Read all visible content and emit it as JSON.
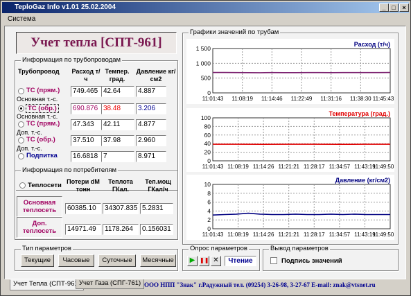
{
  "window": {
    "title": "TeploGaz Info v1.01  25.02.2004",
    "min": "_",
    "max": "□",
    "close": "×"
  },
  "menu": {
    "system": "Система"
  },
  "heat_title": "Учет тепла [СПТ-961]",
  "pipes": {
    "group_label": "Информация по трубопроводам",
    "headers": [
      "Трубопровод",
      "Расход т/ч",
      "Темпер. град.",
      "Давление кг/см2"
    ],
    "rows": [
      {
        "label": "ТС (прям.)",
        "sub": "Основная т.-с.",
        "flow": "749.465",
        "temp": "42.64",
        "press": "4.887",
        "selected": false
      },
      {
        "label": "ТС (обр.)",
        "sub": "Основная т.-с.",
        "flow": "690.876",
        "temp": "38.48",
        "press": "3.206",
        "selected": true
      },
      {
        "label": "ТС (прям.)",
        "sub": "Доп. т.-с.",
        "flow": "47.343",
        "temp": "42.11",
        "press": "4.877",
        "selected": false
      },
      {
        "label": "ТС (обр.)",
        "sub": "Доп. т.-с.",
        "flow": "37.510",
        "temp": "37.98",
        "press": "2.960",
        "selected": false
      },
      {
        "label": "Подпитка",
        "sub": "",
        "flow": "16.6818",
        "temp": "7",
        "press": "8.971",
        "selected": false
      }
    ]
  },
  "consumers": {
    "group_label": "Информация по потребителям",
    "radio_label": "Теплосети",
    "headers": [
      "Потери dM тонн",
      "Теплота ГКал.",
      "Теп.мощ ГКал/ч"
    ],
    "rows": [
      {
        "label": "Основная теплосеть",
        "loss": "60385.10",
        "heat": "34307.835",
        "power": "5.2831"
      },
      {
        "label": "Доп. теплосеть",
        "loss": "14971.49",
        "heat": "1178.264",
        "power": "0.156031"
      }
    ]
  },
  "param_type": {
    "group_label": "Тип параметров",
    "buttons": [
      "Текущие",
      "Часовые",
      "Суточные",
      "Месячные"
    ]
  },
  "poll": {
    "group_label": "Опрос параметров",
    "play": "▶",
    "pause": "❚❚",
    "stop": "✕",
    "status": "Чтение"
  },
  "output": {
    "group_label": "Вывод параметров",
    "checkbox_label": "Подпись значений"
  },
  "charts_group_label": "Графики значений по трубам",
  "chart_data": [
    {
      "type": "line",
      "title": "Расход (т/ч)",
      "title_color": "#000080",
      "series_color": "#7a1f6e",
      "x": [
        "11:01:43",
        "11:08:19",
        "11:14:46",
        "11:22:49",
        "11:31:16",
        "11:38:30",
        "11:45:43"
      ],
      "ylim": [
        0,
        1500
      ],
      "yticks": [
        "1 500",
        "1 000",
        "500",
        "0"
      ],
      "values": [
        690,
        688,
        686,
        684,
        683,
        686,
        684,
        685,
        687,
        686,
        685,
        686,
        687,
        686,
        686,
        690
      ],
      "grid": true
    },
    {
      "type": "line",
      "title": "Температура (град.)",
      "title_color": "#e00000",
      "series_color": "#e00000",
      "x": [
        "11:01:43",
        "11:08:19",
        "11:14:26",
        "11:21:21",
        "11:28:17",
        "11:34:57",
        "11:43:19",
        "11:49:50"
      ],
      "ylim": [
        0,
        100
      ],
      "yticks": [
        "100",
        "80",
        "60",
        "40",
        "20",
        "0"
      ],
      "values": [
        38.5,
        38.5,
        38.4,
        38.5,
        38.5,
        38.4,
        38.5,
        38.5
      ],
      "grid": true
    },
    {
      "type": "line",
      "title": "Давление (кг/см2)",
      "title_color": "#000080",
      "series_color": "#000080",
      "x": [
        "11:01:43",
        "11:08:19",
        "11:14:26",
        "11:21:21",
        "11:28:17",
        "11:34:57",
        "11:43:19",
        "11:49:50"
      ],
      "ylim": [
        0,
        10
      ],
      "yticks": [
        "10",
        "8",
        "6",
        "4",
        "2",
        "0"
      ],
      "values": [
        3.1,
        3.2,
        3.3,
        3.5,
        3.3,
        3.2,
        3.2,
        3.3,
        3.2,
        3.2,
        3.3,
        3.2,
        3.3,
        3.2,
        3.2,
        3.2
      ],
      "grid": true
    }
  ],
  "tabs": [
    "Учет Тепла (СПТ-961)",
    "Учет Газа (СПГ-761)"
  ],
  "footer": "ООО НПП \"Знак\"  г.Радужный  тел. (09254) 3-26-98, 3-27-67   E-mail: znak@vtsnet.ru"
}
